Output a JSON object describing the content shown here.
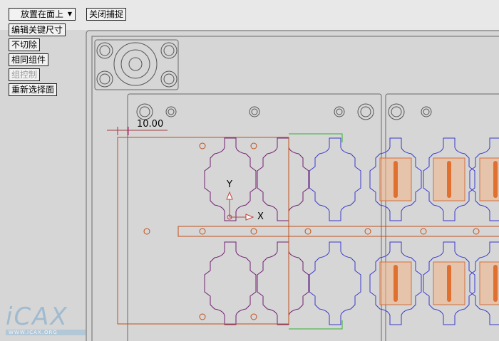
{
  "toolbar": {
    "placement_dropdown": "放置在面上",
    "close_snap": "关闭捕捉",
    "edit_key_dims": "编辑关键尺寸",
    "no_cut": "不切除",
    "same_component": "相同组件",
    "group_control": "组控制",
    "reselect_face": "重新选择面"
  },
  "drawing": {
    "dimension_value": "10.00",
    "axis_y": "Y",
    "axis_x": "X",
    "colors": {
      "outline": "#707070",
      "cavity_blue": "#3a3acc",
      "cavity_purple": "#702070",
      "orange": "#c0501a",
      "green": "#30b030"
    }
  },
  "watermark": {
    "logo": "iCAX",
    "url": "WWW.ICAX.ORG"
  }
}
